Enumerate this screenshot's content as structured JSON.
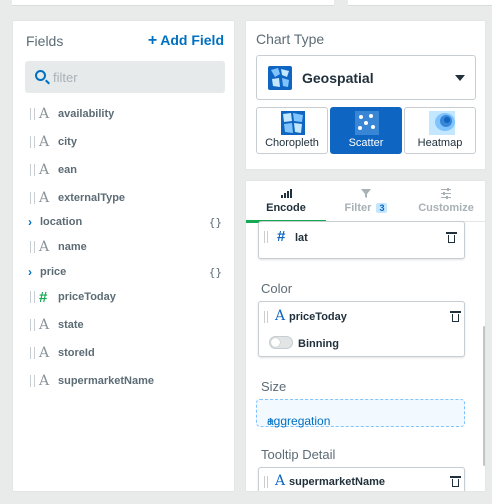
{
  "fields_panel": {
    "title": "Fields",
    "add_field_label": "Add Field",
    "filter_placeholder": "filter",
    "items": [
      {
        "name": "availability",
        "type": "string"
      },
      {
        "name": "city",
        "type": "string"
      },
      {
        "name": "ean",
        "type": "string"
      },
      {
        "name": "externalType",
        "type": "string"
      },
      {
        "name": "location",
        "type": "object",
        "braces": "{}"
      },
      {
        "name": "name",
        "type": "string"
      },
      {
        "name": "price",
        "type": "object",
        "braces": "{}"
      },
      {
        "name": "priceToday",
        "type": "number"
      },
      {
        "name": "state",
        "type": "string"
      },
      {
        "name": "storeId",
        "type": "string"
      },
      {
        "name": "supermarketName",
        "type": "string"
      }
    ]
  },
  "chart_type": {
    "title": "Chart Type",
    "selected": "Geospatial",
    "subtypes": [
      {
        "label": "Choropleth",
        "active": false
      },
      {
        "label": "Scatter",
        "active": true
      },
      {
        "label": "Heatmap",
        "active": false
      }
    ]
  },
  "encode_panel": {
    "tabs": [
      {
        "label": "Encode",
        "active": true
      },
      {
        "label": "Filter",
        "badge": "3"
      },
      {
        "label": "Customize"
      }
    ],
    "lat_field": "lat",
    "color_section": {
      "title": "Color",
      "field": "priceToday",
      "binning_label": "Binning",
      "binning_on": false
    },
    "size_section": {
      "title": "Size",
      "placeholder": "aggregation",
      "plus": "+"
    },
    "tooltip_section": {
      "title": "Tooltip Detail",
      "field": "supermarketName"
    }
  },
  "colors": {
    "accent_blue": "#0f66c2",
    "link_blue": "#0070c0",
    "green": "#13aa52"
  }
}
